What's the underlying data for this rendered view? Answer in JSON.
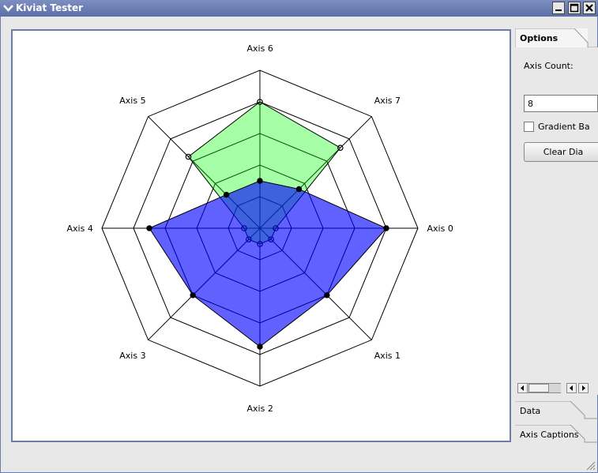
{
  "window": {
    "title": "Kiviat Tester"
  },
  "axes": [
    "Axis 0",
    "Axis 1",
    "Axis 2",
    "Axis 3",
    "Axis 4",
    "Axis 5",
    "Axis 6",
    "Axis 7"
  ],
  "rings": 5,
  "series": [
    {
      "color": "#00ff00",
      "fill_opacity": 0.35,
      "stroke": "#000000",
      "marker": "open",
      "values": [
        0.1,
        0.1,
        0.1,
        0.1,
        0.1,
        0.64,
        0.8,
        0.72
      ]
    },
    {
      "color": "#0000ff",
      "fill_opacity": 0.62,
      "stroke": "#000000",
      "marker": "filled",
      "values": [
        0.8,
        0.6,
        0.75,
        0.6,
        0.7,
        0.3,
        0.3,
        0.35
      ]
    }
  ],
  "tabs": {
    "options": "Options",
    "data": "Data",
    "axis_captions": "Axis Captions"
  },
  "options": {
    "axis_count_label": "Axis Count:",
    "axis_count_value": "8",
    "gradient_label": "Gradient Ba",
    "clear_button": "Clear Dia"
  }
}
